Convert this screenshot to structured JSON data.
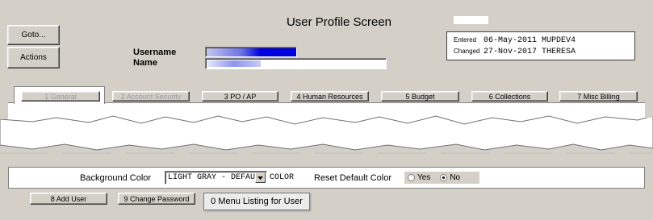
{
  "screen": {
    "title": "User Profile Screen"
  },
  "left_buttons": {
    "goto": "Goto...",
    "actions": "Actions"
  },
  "user": {
    "username_label": "Username",
    "name_label": "Name"
  },
  "audit": {
    "entered_label": "Entered",
    "entered_value": "06-May-2011 MUPDEV4",
    "changed_label": "Changed",
    "changed_value": "27-Nov-2017 THERESA"
  },
  "tabs": [
    {
      "label": "1 General",
      "state": "active-disabled"
    },
    {
      "label": "2 Account Security",
      "state": "disabled"
    },
    {
      "label": "3 PO / AP",
      "state": "enabled"
    },
    {
      "label": "4 Human Resources",
      "state": "enabled"
    },
    {
      "label": "5 Budget",
      "state": "enabled"
    },
    {
      "label": "6 Collections",
      "state": "enabled"
    },
    {
      "label": "7 Misc Billing",
      "state": "enabled"
    }
  ],
  "settings": {
    "background_color_label": "Background Color",
    "background_color_value": "LIGHT GRAY - DEFAULT COLOR",
    "reset_label": "Reset Default Color",
    "reset_options": [
      "Yes",
      "No"
    ],
    "reset_selected": "No"
  },
  "bottom_buttons": {
    "add_user": "8 Add User",
    "change_password": "9 Change Password",
    "menu_listing": "0 Menu Listing for User"
  },
  "colors": {
    "panel": "#d4d0c8",
    "selection_blue": "#0000e0"
  }
}
